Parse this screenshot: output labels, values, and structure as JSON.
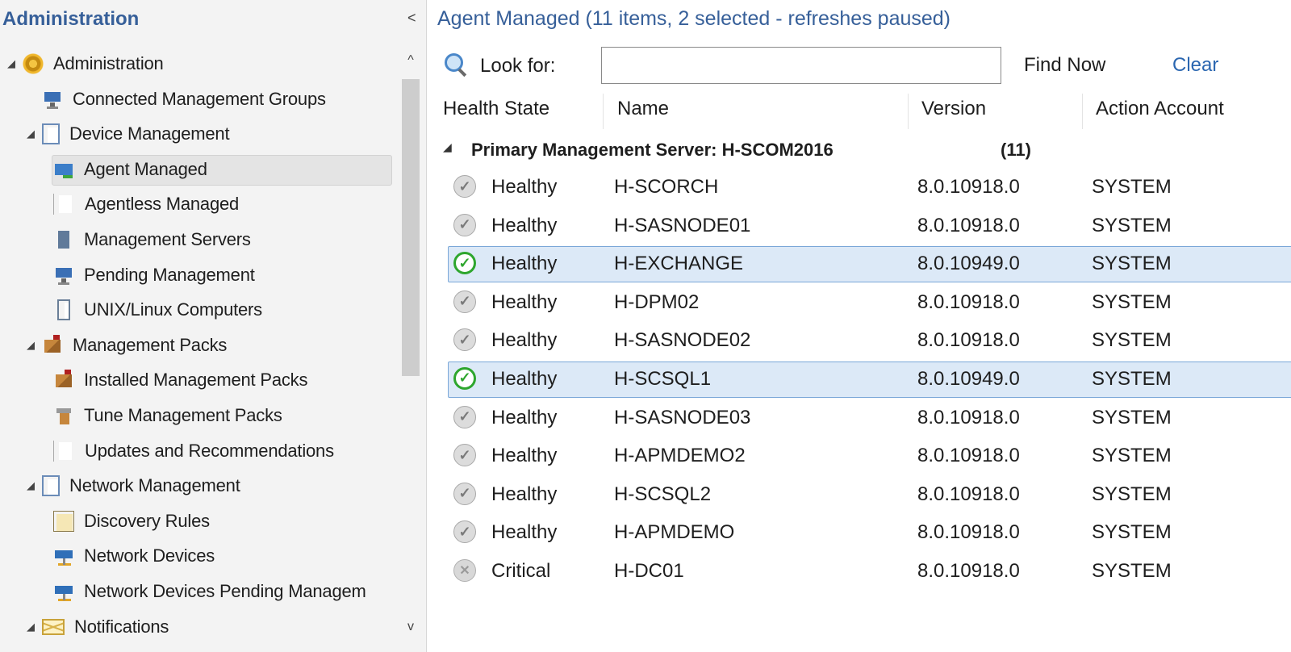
{
  "nav": {
    "title": "Administration",
    "collapse_glyph": "<",
    "items": [
      {
        "label": "Administration",
        "icon": "gear-icon",
        "expander": "◢"
      },
      {
        "label": "Connected Management Groups",
        "icon": "connected-groups-icon"
      },
      {
        "label": "Device Management",
        "icon": "device-management-icon",
        "expander": "◢"
      },
      {
        "label": "Agent Managed",
        "icon": "agent-managed-icon"
      },
      {
        "label": "Agentless Managed",
        "icon": "agentless-managed-icon"
      },
      {
        "label": "Management Servers",
        "icon": "management-servers-icon"
      },
      {
        "label": "Pending Management",
        "icon": "pending-management-icon"
      },
      {
        "label": "UNIX/Linux Computers",
        "icon": "unix-linux-icon"
      },
      {
        "label": "Management Packs",
        "icon": "management-packs-icon",
        "expander": "◢"
      },
      {
        "label": "Installed Management Packs",
        "icon": "installed-packs-icon"
      },
      {
        "label": "Tune Management Packs",
        "icon": "tune-packs-icon"
      },
      {
        "label": "Updates and Recommendations",
        "icon": "updates-icon"
      },
      {
        "label": "Network Management",
        "icon": "network-management-icon",
        "expander": "◢"
      },
      {
        "label": "Discovery Rules",
        "icon": "discovery-rules-icon"
      },
      {
        "label": "Network Devices",
        "icon": "network-devices-icon"
      },
      {
        "label": "Network Devices Pending Managem",
        "icon": "network-pending-icon"
      },
      {
        "label": "Notifications",
        "icon": "envelope-icon",
        "expander": "◢"
      }
    ],
    "scroll_up": "^",
    "scroll_down": "v"
  },
  "content": {
    "title_main": "Agent Managed",
    "title_sub": " (11 items, 2 selected - refreshes paused)",
    "search": {
      "label": "Look for:",
      "value": "",
      "find_now": "Find Now",
      "clear": "Clear"
    },
    "columns": [
      "Health State",
      "Name",
      "Version",
      "Action Account"
    ],
    "group": {
      "expander": "◢",
      "label": "Primary Management Server: H-SCOM2016",
      "count": "(11)"
    },
    "rows": [
      {
        "health": "Healthy",
        "name": "H-SCORCH",
        "version": "8.0.10918.0",
        "account": "SYSTEM",
        "icon": "grey",
        "selected": false
      },
      {
        "health": "Healthy",
        "name": "H-SASNODE01",
        "version": "8.0.10918.0",
        "account": "SYSTEM",
        "icon": "grey",
        "selected": false
      },
      {
        "health": "Healthy",
        "name": "H-EXCHANGE",
        "version": "8.0.10949.0",
        "account": "SYSTEM",
        "icon": "green",
        "selected": true
      },
      {
        "health": "Healthy",
        "name": "H-DPM02",
        "version": "8.0.10918.0",
        "account": "SYSTEM",
        "icon": "grey",
        "selected": false
      },
      {
        "health": "Healthy",
        "name": "H-SASNODE02",
        "version": "8.0.10918.0",
        "account": "SYSTEM",
        "icon": "grey",
        "selected": false
      },
      {
        "health": "Healthy",
        "name": "H-SCSQL1",
        "version": "8.0.10949.0",
        "account": "SYSTEM",
        "icon": "green",
        "selected": true
      },
      {
        "health": "Healthy",
        "name": "H-SASNODE03",
        "version": "8.0.10918.0",
        "account": "SYSTEM",
        "icon": "grey",
        "selected": false
      },
      {
        "health": "Healthy",
        "name": "H-APMDEMO2",
        "version": "8.0.10918.0",
        "account": "SYSTEM",
        "icon": "grey",
        "selected": false
      },
      {
        "health": "Healthy",
        "name": "H-SCSQL2",
        "version": "8.0.10918.0",
        "account": "SYSTEM",
        "icon": "grey",
        "selected": false
      },
      {
        "health": "Healthy",
        "name": "H-APMDEMO",
        "version": "8.0.10918.0",
        "account": "SYSTEM",
        "icon": "grey",
        "selected": false
      },
      {
        "health": "Critical",
        "name": "H-DC01",
        "version": "8.0.10918.0",
        "account": "SYSTEM",
        "icon": "critical",
        "selected": false
      }
    ]
  },
  "colors": {
    "title_blue": "#365f99",
    "selection_bg": "#dce9f7",
    "selection_border": "#7aa7d8",
    "healthy_green": "#2ea62e"
  }
}
